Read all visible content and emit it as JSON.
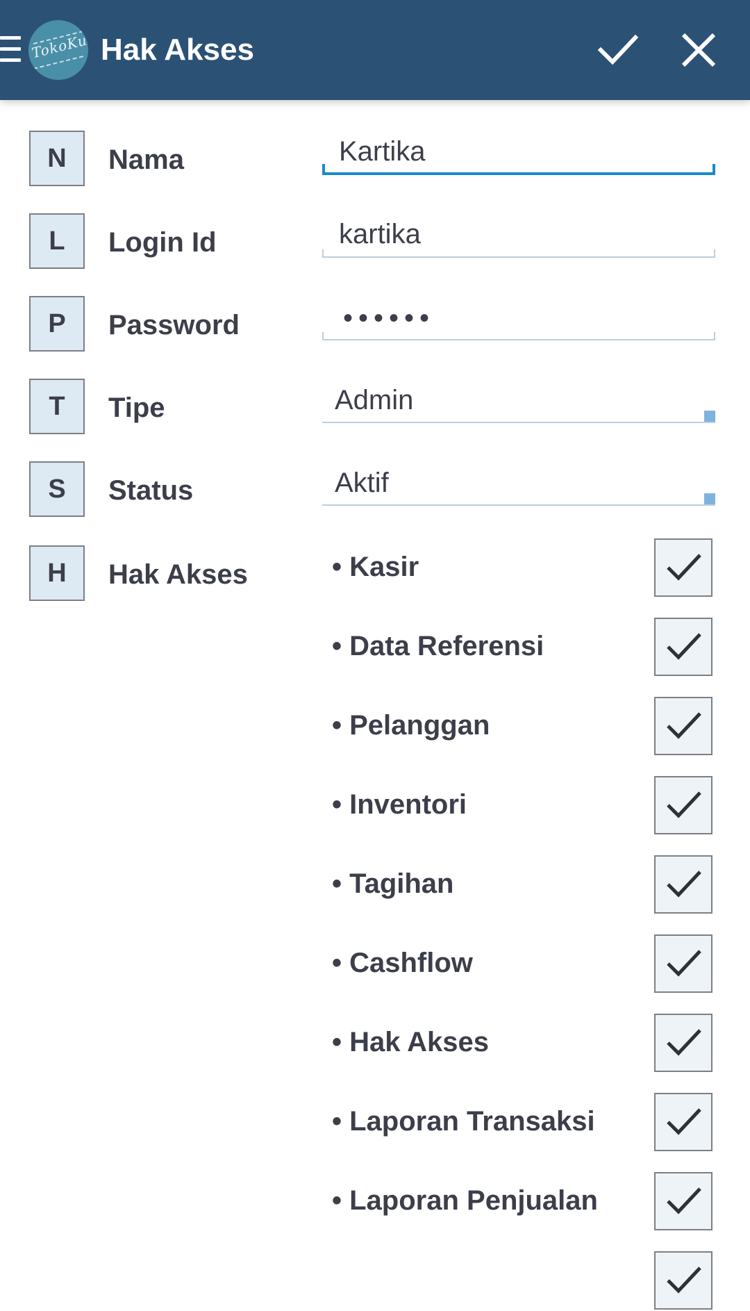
{
  "header": {
    "title": "Hak Akses",
    "logo_text": "TokoKu",
    "menu_icon": "hamburger-menu-icon",
    "confirm_icon": "checkmark-icon",
    "close_icon": "close-x-icon"
  },
  "form": {
    "nama": {
      "initial": "N",
      "label": "Nama",
      "value": "Kartika"
    },
    "login": {
      "initial": "L",
      "label": "Login Id",
      "value": "kartika"
    },
    "password": {
      "initial": "P",
      "label": "Password",
      "value": "••••••"
    },
    "tipe": {
      "initial": "T",
      "label": "Tipe",
      "value": "Admin"
    },
    "status": {
      "initial": "S",
      "label": "Status",
      "value": "Aktif"
    },
    "hak_akses": {
      "initial": "H",
      "label": "Hak Akses"
    }
  },
  "permissions": [
    {
      "label": "• Kasir",
      "checked": true
    },
    {
      "label": "• Data Referensi",
      "checked": true
    },
    {
      "label": "• Pelanggan",
      "checked": true
    },
    {
      "label": "• Inventori",
      "checked": true
    },
    {
      "label": "• Tagihan",
      "checked": true
    },
    {
      "label": "• Cashflow",
      "checked": true
    },
    {
      "label": "• Hak Akses",
      "checked": true
    },
    {
      "label": "• Laporan Transaksi",
      "checked": true
    },
    {
      "label": "• Laporan Penjualan",
      "checked": true
    },
    {
      "label": "",
      "checked": true
    }
  ],
  "colors": {
    "appbar": "#2b5275",
    "focus_accent": "#1b8bc6",
    "initial_box_bg": "#dde9f3",
    "text": "#3c3f4a"
  }
}
